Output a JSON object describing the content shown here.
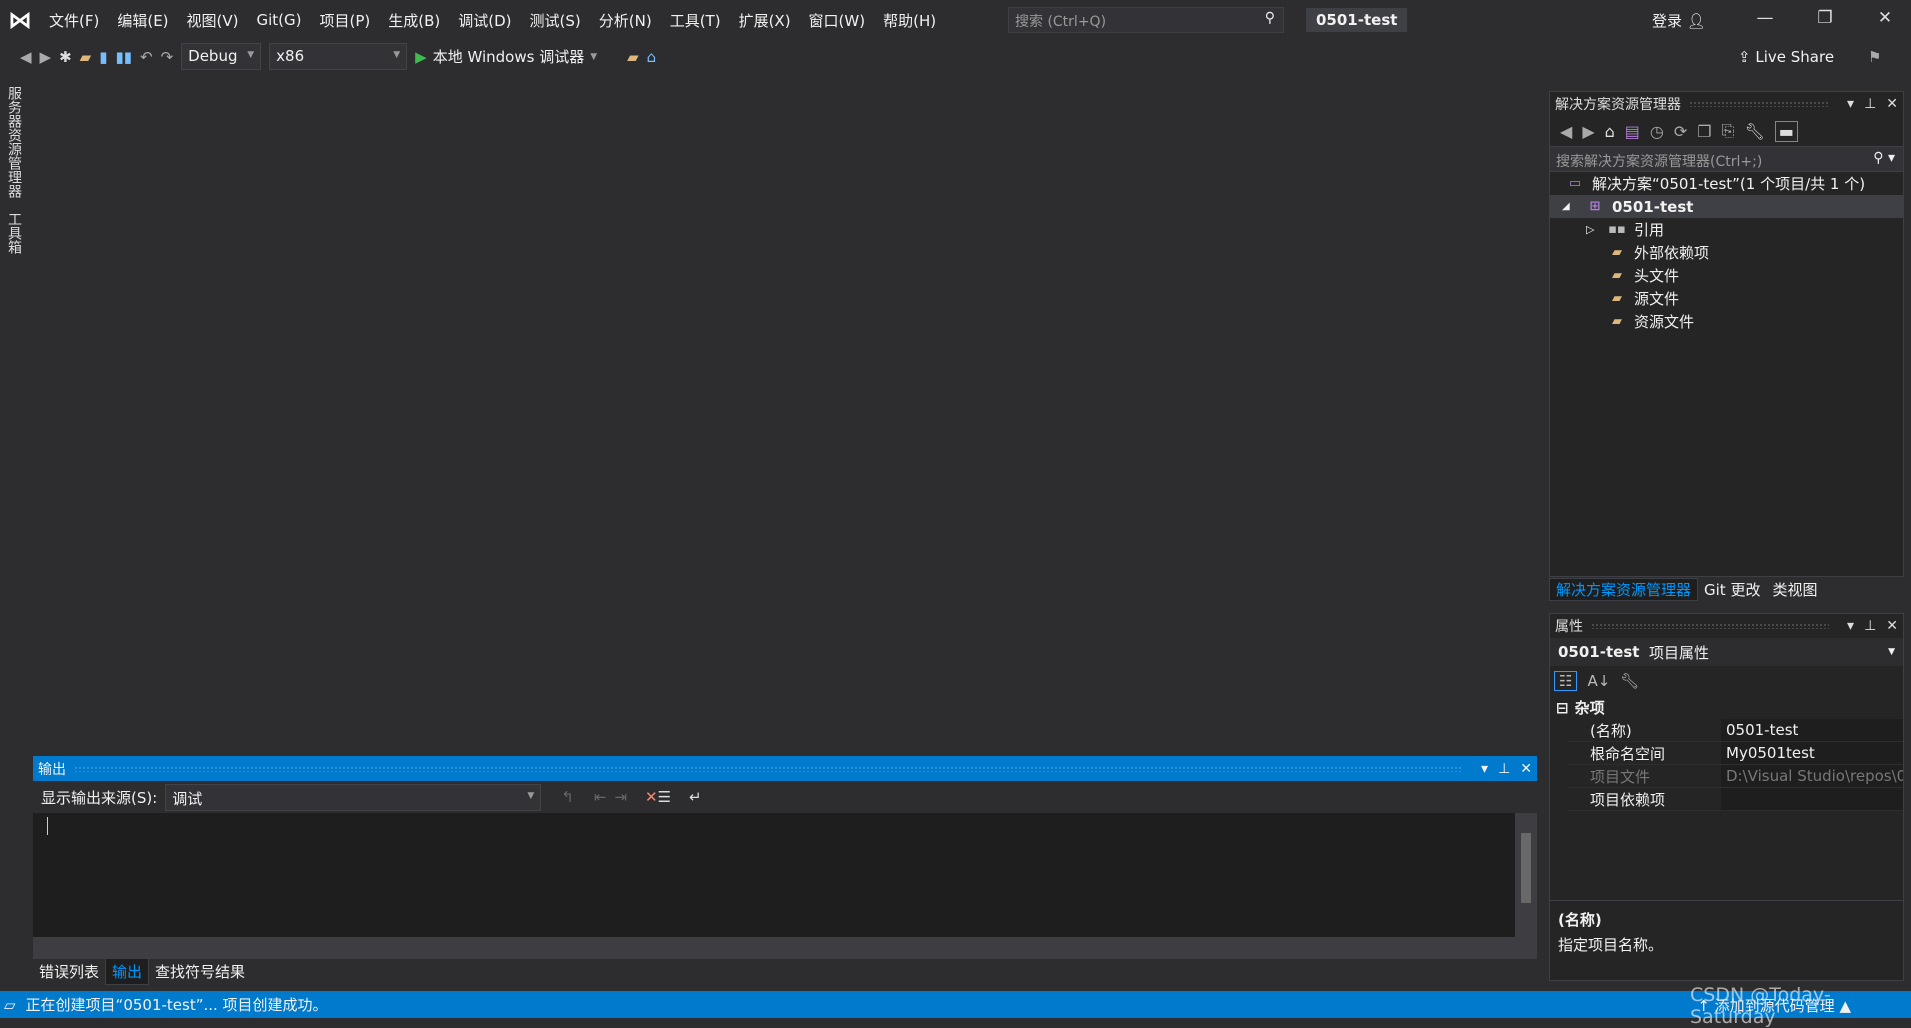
{
  "titlebar": {
    "menus": [
      "文件(F)",
      "编辑(E)",
      "视图(V)",
      "Git(G)",
      "项目(P)",
      "生成(B)",
      "调试(D)",
      "测试(S)",
      "分析(N)",
      "工具(T)",
      "扩展(X)",
      "窗口(W)",
      "帮助(H)"
    ],
    "search_placeholder": "搜索 (Ctrl+Q)",
    "project": "0501-test",
    "login": "登录"
  },
  "toolbar": {
    "config": "Debug",
    "platform": "x86",
    "run_label": "本地 Windows 调试器",
    "live_share": "Live Share"
  },
  "left_strip": [
    "服务器资源管理器",
    "工具箱"
  ],
  "solution_explorer": {
    "title": "解决方案资源管理器",
    "search_placeholder": "搜索解决方案资源管理器(Ctrl+;)",
    "solution": "解决方案“0501-test”(1 个项目/共 1 个)",
    "project": "0501-test",
    "items": [
      "引用",
      "外部依赖项",
      "头文件",
      "源文件",
      "资源文件"
    ],
    "tabs": [
      "解决方案资源管理器",
      "Git 更改",
      "类视图"
    ]
  },
  "properties": {
    "title": "属性",
    "object_name": "0501-test",
    "object_type": "项目属性",
    "category": "杂项",
    "rows": [
      {
        "key": "(名称)",
        "value": "0501-test"
      },
      {
        "key": "根命名空间",
        "value": "My0501test"
      },
      {
        "key": "项目文件",
        "value": "D:\\Visual Studio\\repos\\0"
      },
      {
        "key": "项目依赖项",
        "value": ""
      }
    ],
    "desc_title": "(名称)",
    "desc_text": "指定项目名称。"
  },
  "output": {
    "title": "输出",
    "source_label": "显示输出来源(S):",
    "source_value": "调试",
    "tabs": [
      "错误列表",
      "输出",
      "查找符号结果"
    ]
  },
  "status": {
    "message": "正在创建项目“0501-test”... 项目创建成功。",
    "right": "添加到源代码管理"
  },
  "watermark": "CSDN @Today-Saturday",
  "colors": {
    "accent": "#007acc",
    "background": "#2d2d30"
  }
}
